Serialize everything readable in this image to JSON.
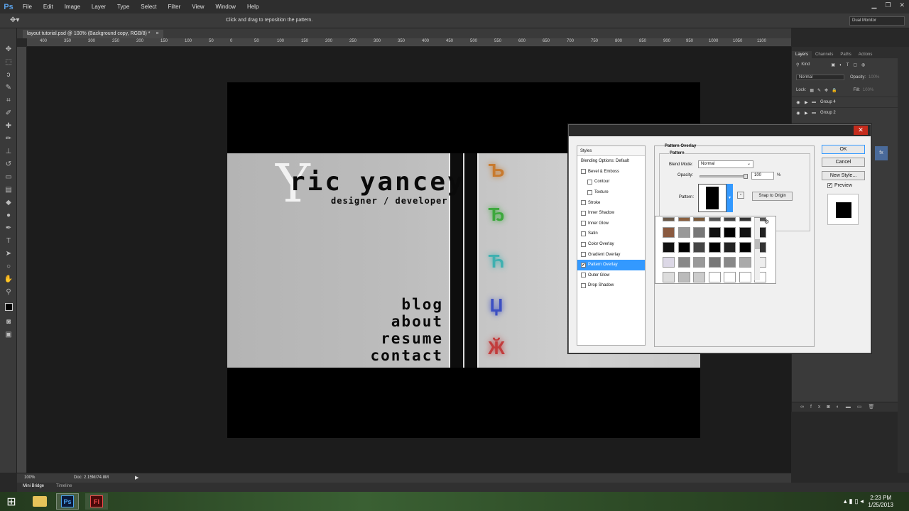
{
  "app": {
    "logo": "Ps",
    "workspace": "Dual Monitor",
    "option_hint": "Click and drag to reposition the pattern."
  },
  "menu": [
    "File",
    "Edit",
    "Image",
    "Layer",
    "Type",
    "Select",
    "Filter",
    "View",
    "Window",
    "Help"
  ],
  "document": {
    "tab_title": "layout tutorial.psd @ 100% (Background copy, RGB/8) *",
    "close": "×"
  },
  "ruler_numbers": [
    "400",
    "350",
    "300",
    "250",
    "200",
    "150",
    "100",
    "50",
    "0",
    "50",
    "100",
    "150",
    "200",
    "250",
    "300",
    "350",
    "400",
    "450",
    "500",
    "550",
    "600",
    "650",
    "700",
    "750",
    "800",
    "850",
    "900",
    "950",
    "1000",
    "1050",
    "1100"
  ],
  "canvas": {
    "logo_mark": "Y",
    "name": "ric yancey",
    "tagline": "designer / developer",
    "nav": [
      "blog",
      "about",
      "resume",
      "contact"
    ],
    "glyph_colors": [
      "#c87a2e",
      "#3da83d",
      "#3fb0b0",
      "#3c4fc2",
      "#c23c3c"
    ],
    "glyphs": [
      "Ъ",
      "Ђ",
      "Ћ",
      "Џ",
      "Ӂ"
    ]
  },
  "status": {
    "zoom": "100%",
    "doc": "Doc: 2.15M/74.8M"
  },
  "bottom_tabs": [
    "Mini Bridge",
    "Timeline"
  ],
  "layers_panel": {
    "tabs": [
      "Layers",
      "Channels",
      "Paths",
      "Actions"
    ],
    "filter": "Kind",
    "blend": "Normal",
    "opacity_label": "Opacity:",
    "opacity_value": "100%",
    "lock_label": "Lock:",
    "fill_label": "Fill:",
    "fill_value": "100%",
    "layers": [
      "Group 4",
      "Group 2"
    ]
  },
  "dialog": {
    "styles_header": "Styles",
    "styles": [
      {
        "label": "Blending Options: Default",
        "checkbox": false,
        "checked": false,
        "indent": false,
        "selected": false
      },
      {
        "label": "Bevel & Emboss",
        "checkbox": true,
        "checked": false,
        "indent": false,
        "selected": false
      },
      {
        "label": "Contour",
        "checkbox": true,
        "checked": false,
        "indent": true,
        "selected": false
      },
      {
        "label": "Texture",
        "checkbox": true,
        "checked": false,
        "indent": true,
        "selected": false
      },
      {
        "label": "Stroke",
        "checkbox": true,
        "checked": false,
        "indent": false,
        "selected": false
      },
      {
        "label": "Inner Shadow",
        "checkbox": true,
        "checked": false,
        "indent": false,
        "selected": false
      },
      {
        "label": "Inner Glow",
        "checkbox": true,
        "checked": false,
        "indent": false,
        "selected": false
      },
      {
        "label": "Satin",
        "checkbox": true,
        "checked": false,
        "indent": false,
        "selected": false
      },
      {
        "label": "Color Overlay",
        "checkbox": true,
        "checked": false,
        "indent": false,
        "selected": false
      },
      {
        "label": "Gradient Overlay",
        "checkbox": true,
        "checked": false,
        "indent": false,
        "selected": false
      },
      {
        "label": "Pattern Overlay",
        "checkbox": true,
        "checked": true,
        "indent": false,
        "selected": true
      },
      {
        "label": "Outer Glow",
        "checkbox": true,
        "checked": false,
        "indent": false,
        "selected": false
      },
      {
        "label": "Drop Shadow",
        "checkbox": true,
        "checked": false,
        "indent": false,
        "selected": false
      }
    ],
    "section_title": "Pattern Overlay",
    "group_title": "Pattern",
    "blend_label": "Blend Mode:",
    "blend_value": "Normal",
    "opacity_label": "Opacity:",
    "opacity_value": "100",
    "percent": "%",
    "pattern_label": "Pattern:",
    "snap_button": "Snap to Origin",
    "ok": "OK",
    "cancel": "Cancel",
    "new_style": "New Style...",
    "preview_label": "Preview",
    "preview_checked": true
  },
  "taskbar": {
    "time": "2:23 PM",
    "date": "1/25/2013"
  }
}
